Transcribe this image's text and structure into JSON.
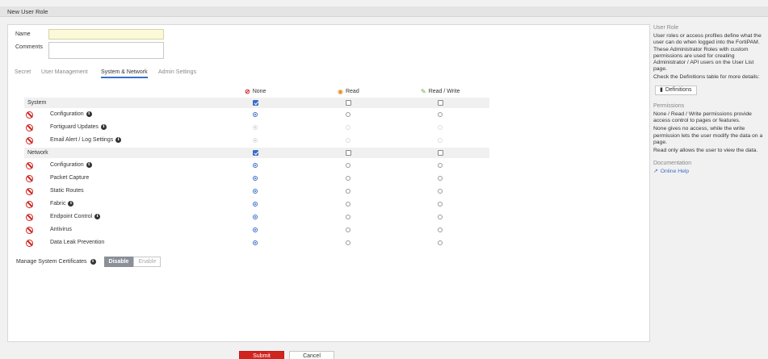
{
  "header": {
    "title": "New User Role"
  },
  "form": {
    "name_label": "Name",
    "name_value": "",
    "comments_label": "Comments",
    "comments_value": ""
  },
  "tabs": [
    {
      "label": "Secret",
      "active": false
    },
    {
      "label": "User Management",
      "active": false
    },
    {
      "label": "System & Network",
      "active": true
    },
    {
      "label": "Admin Settings",
      "active": false
    }
  ],
  "columns": {
    "none": "None",
    "read": "Read",
    "read_write": "Read / Write"
  },
  "sections": [
    {
      "label": "System",
      "header_checks": {
        "none": true,
        "read": false,
        "read_write": false
      },
      "rows": [
        {
          "label": "Configuration",
          "info": true,
          "selected": "none",
          "disabled": false
        },
        {
          "label": "Fortiguard Updates",
          "info": true,
          "selected": "none",
          "disabled": true
        },
        {
          "label": "Email Alert / Log Settings",
          "info": true,
          "selected": "none",
          "disabled": true
        }
      ]
    },
    {
      "label": "Network",
      "header_checks": {
        "none": true,
        "read": false,
        "read_write": false
      },
      "rows": [
        {
          "label": "Configuration",
          "info": true,
          "selected": "none",
          "disabled": false
        },
        {
          "label": "Packet Capture",
          "info": false,
          "selected": "none",
          "disabled": false
        },
        {
          "label": "Static Routes",
          "info": false,
          "selected": "none",
          "disabled": false
        },
        {
          "label": "Fabric",
          "info": true,
          "selected": "none",
          "disabled": false
        },
        {
          "label": "Endpoint Control",
          "info": true,
          "selected": "none",
          "disabled": false
        },
        {
          "label": "Antivirus",
          "info": false,
          "selected": "none",
          "disabled": false
        },
        {
          "label": "Data Leak Prevention",
          "info": false,
          "selected": "none",
          "disabled": false
        }
      ]
    }
  ],
  "certificates": {
    "label": "Manage System Certificates",
    "options": [
      "Disable",
      "Enable"
    ],
    "selected": "Disable"
  },
  "footer": {
    "submit": "Submit",
    "cancel": "Cancel"
  },
  "sidebar": {
    "user_role_title": "User Role",
    "user_role_text": "User roles or access profiles define what the user can do when logged into the FortiPAM. These Administrator Roles with custom permissions are used for creating Administrator / API users on the User List page.",
    "definitions_text": "Check the Definitions table for more details:",
    "definitions_button": "Definitions",
    "permissions_title": "Permissions",
    "permissions_text1": "None / Read / Write permissions provide access control to pages or features.",
    "permissions_text2": "None gives no access, while the write permission lets the user modify the data on a page.",
    "permissions_text3": "Read only allows the user to view the data.",
    "documentation_title": "Documentation",
    "online_help": "Online Help"
  },
  "colors": {
    "accent": "#3a6fc7",
    "danger": "#d0241f",
    "read": "#e08a22",
    "write": "#6aa43b"
  }
}
